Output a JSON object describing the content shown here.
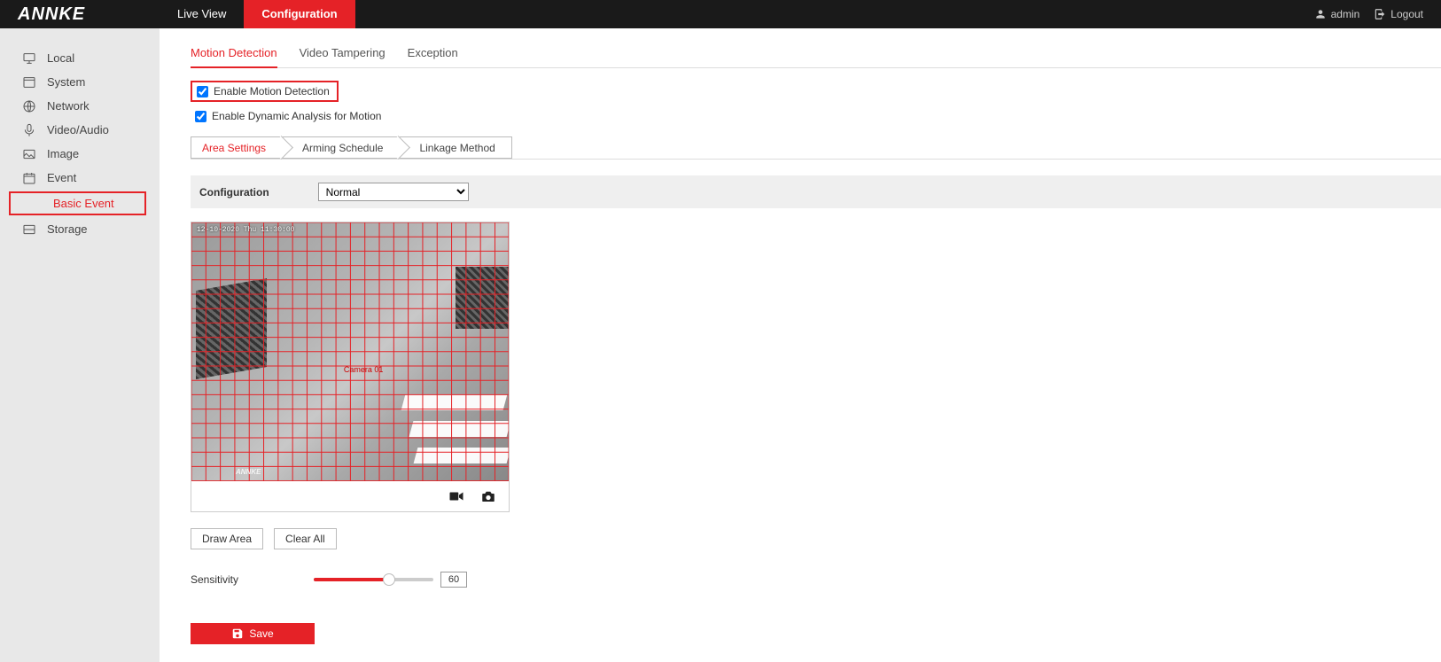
{
  "brand": "ANNKE",
  "topnav": {
    "live_view": "Live View",
    "configuration": "Configuration"
  },
  "user": {
    "name": "admin",
    "logout": "Logout"
  },
  "sidebar": {
    "local": "Local",
    "system": "System",
    "network": "Network",
    "video_audio": "Video/Audio",
    "image": "Image",
    "event": "Event",
    "basic_event": "Basic Event",
    "storage": "Storage"
  },
  "tabs": {
    "motion_detection": "Motion Detection",
    "video_tampering": "Video Tampering",
    "exception": "Exception"
  },
  "checkboxes": {
    "enable_motion": "Enable Motion Detection",
    "enable_dynamic": "Enable Dynamic Analysis for Motion"
  },
  "breadcrumb": {
    "area_settings": "Area Settings",
    "arming_schedule": "Arming Schedule",
    "linkage_method": "Linkage Method"
  },
  "config": {
    "label": "Configuration",
    "selected": "Normal"
  },
  "video": {
    "timestamp": "12-10-2020 Thu 11:30:00",
    "camera": "Camera 01",
    "watermark": "ANNKE"
  },
  "buttons": {
    "draw_area": "Draw Area",
    "clear_all": "Clear All",
    "save": "Save"
  },
  "sensitivity": {
    "label": "Sensitivity",
    "value": "60"
  }
}
